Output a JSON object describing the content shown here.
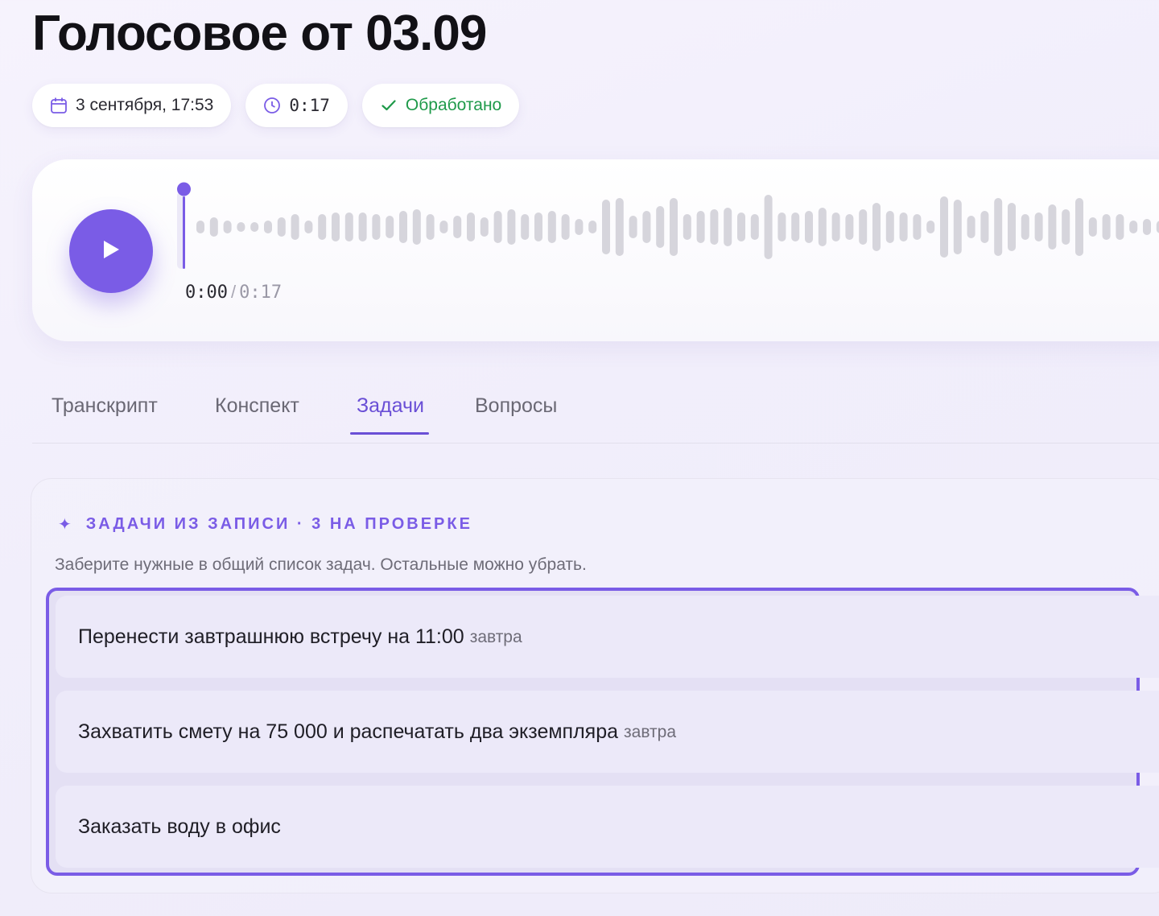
{
  "header": {
    "title": "Голосовое от 03.09"
  },
  "meta": {
    "date": "3 сентября, 17:53",
    "duration": "0:17",
    "status": "Обработано",
    "status_color": "#1f9a4a"
  },
  "player": {
    "current_time": "0:00",
    "separator": "/",
    "total_time": "0:17",
    "progress": 0,
    "accent": "#7a5ce6"
  },
  "tabs": [
    {
      "label": "Транскрипт",
      "active": false
    },
    {
      "label": "Конспект",
      "active": false
    },
    {
      "label": "Задачи",
      "active": true
    },
    {
      "label": "Вопросы",
      "active": false
    }
  ],
  "tasks_panel": {
    "title": "ЗАДАЧИ ИЗ ЗАПИСИ · 3 НА ПРОВЕРКЕ",
    "subtitle": "Заберите нужные в общий список задач. Остальные можно убрать.",
    "items": [
      {
        "text": "Перенести завтрашнюю встречу на 11:00",
        "due": "завтра"
      },
      {
        "text": "Захватить смету на 75 000 и распечатать два экземпляра",
        "due": "завтра"
      },
      {
        "text": "Заказать воду в офис",
        "due": ""
      }
    ]
  }
}
